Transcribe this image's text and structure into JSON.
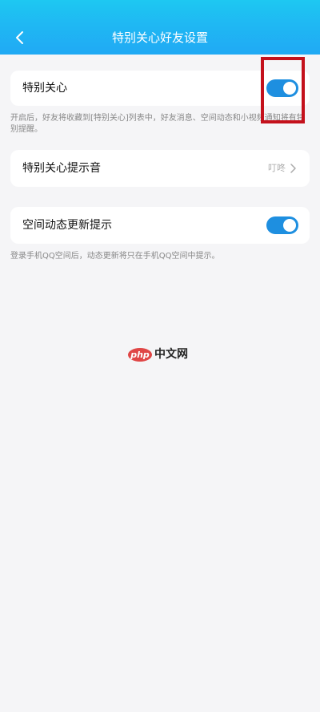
{
  "header": {
    "title": "特别关心好友设置",
    "back_icon": "chevron-left-icon"
  },
  "special_care": {
    "label": "特别关心",
    "toggle_on": true,
    "description": "开启后，好友将收藏到[特别关心]列表中，好友消息、空间动态和小视频通知将有特别提醒。"
  },
  "sound": {
    "label": "特别关心提示音",
    "value": "叮咚",
    "chevron_icon": "chevron-right-icon"
  },
  "space_update": {
    "label": "空间动态更新提示",
    "toggle_on": true,
    "description": "登录手机QQ空间后，动态更新将只在手机QQ空间中提示。"
  },
  "watermark": {
    "badge": "php",
    "text": "中文网"
  },
  "colors": {
    "header_top": "#1ec8f2",
    "header_bottom": "#20a9f4",
    "toggle_on": "#1e8fe0",
    "highlight": "#c4111c",
    "background": "#f5f5f7"
  }
}
